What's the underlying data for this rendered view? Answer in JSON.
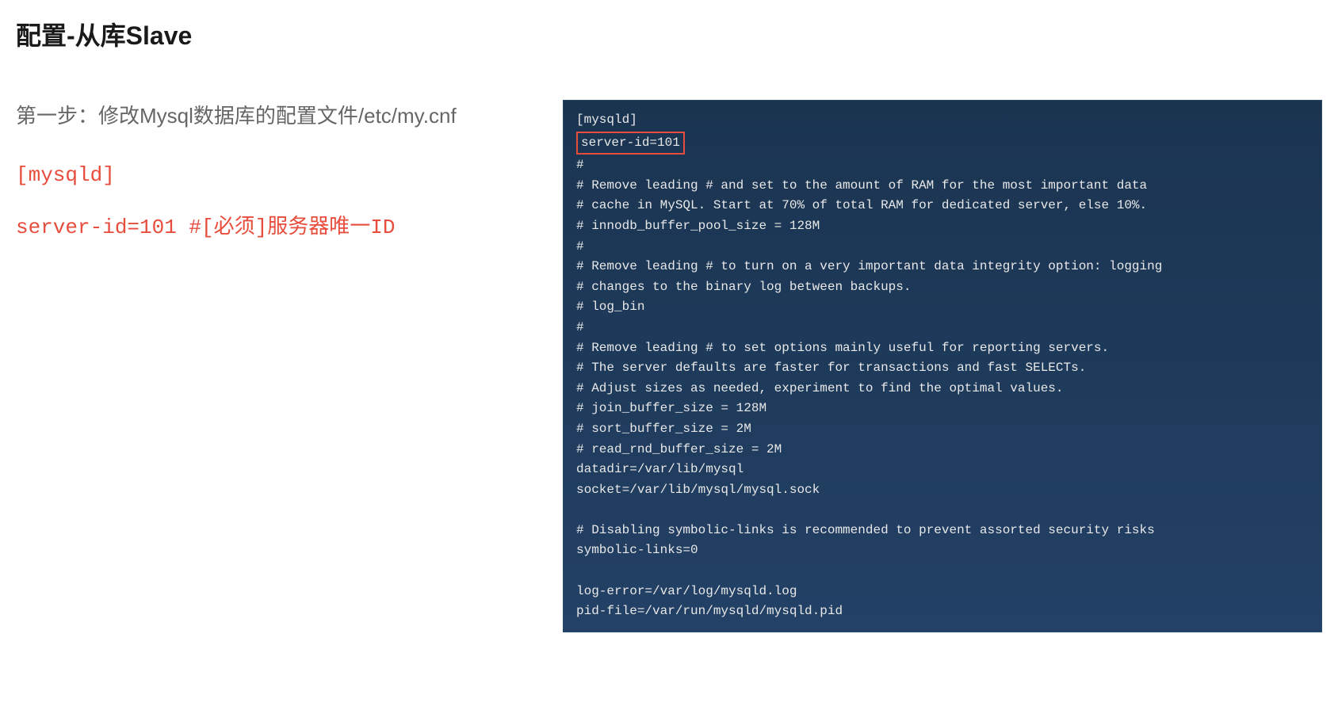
{
  "title": "配置-从库Slave",
  "stepText": "第一步：修改Mysql数据库的配置文件/etc/my.cnf",
  "configLines": [
    "[mysqld]",
    "server-id=101 #[必须]服务器唯一ID"
  ],
  "terminal": {
    "line1": "[mysqld]",
    "highlightedLine": "server-id=101",
    "lines": [
      "#",
      "# Remove leading # and set to the amount of RAM for the most important data",
      "# cache in MySQL. Start at 70% of total RAM for dedicated server, else 10%.",
      "# innodb_buffer_pool_size = 128M",
      "#",
      "# Remove leading # to turn on a very important data integrity option: logging",
      "# changes to the binary log between backups.",
      "# log_bin",
      "#",
      "# Remove leading # to set options mainly useful for reporting servers.",
      "# The server defaults are faster for transactions and fast SELECTs.",
      "# Adjust sizes as needed, experiment to find the optimal values.",
      "# join_buffer_size = 128M",
      "# sort_buffer_size = 2M",
      "# read_rnd_buffer_size = 2M",
      "datadir=/var/lib/mysql",
      "socket=/var/lib/mysql/mysql.sock",
      "",
      "# Disabling symbolic-links is recommended to prevent assorted security risks",
      "symbolic-links=0",
      "",
      "log-error=/var/log/mysqld.log",
      "pid-file=/var/run/mysqld/mysqld.pid"
    ]
  }
}
